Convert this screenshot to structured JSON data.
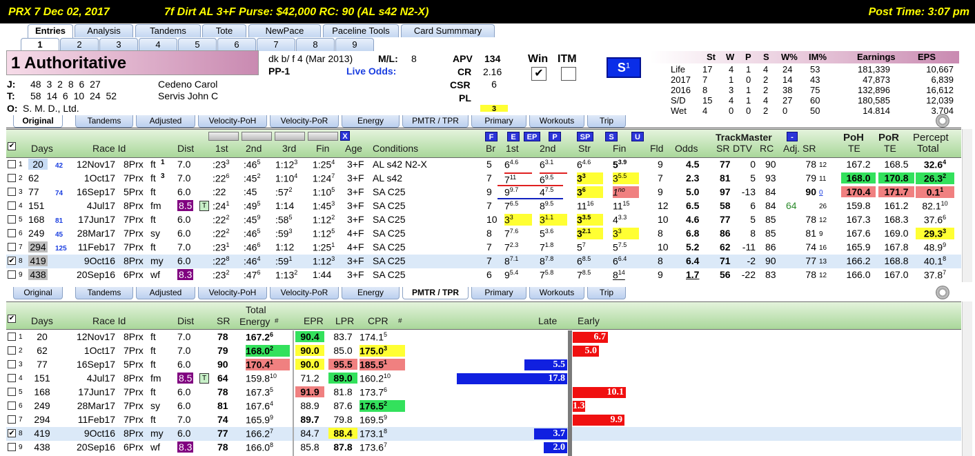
{
  "topbar": {
    "race": "PRX  7   Dec 02, 2017",
    "surface": "7f  Dirt   AL  3+F   Purse: $42,000   RC: 90  (AL s42 N2-X)",
    "post": "Post Time: 3:07 pm"
  },
  "main_tabs": [
    "Entries",
    "Analysis",
    "Tandems",
    "Tote",
    "NewPace",
    "Paceline Tools",
    "Card Summmary"
  ],
  "horse_tabs": [
    "1",
    "2",
    "3",
    "4",
    "5",
    "6",
    "7",
    "8",
    "9"
  ],
  "horse": {
    "name": "1  Authoritative",
    "breeding": "dk b/ f 4  (Mar 2013)",
    "ml_label": "M/L:",
    "ml": "8",
    "pp": "PP-1",
    "live_odds": "Live Odds:",
    "j_label": "J:",
    "j_stats": "48    3    2    8     6    27",
    "jockey": "Cedeno Carol",
    "t_label": "T:",
    "t_stats": "58   14    6   10    24    52",
    "trainer": "Servis John C",
    "o_label": "O:",
    "owner": "S. M. D., Ltd."
  },
  "ratings": {
    "apv_label": "APV",
    "apv": "134",
    "cr_label": "CR",
    "cr": "2.16",
    "csr_label": "CSR",
    "csr": "6",
    "pl_label": "PL",
    "pl": "3"
  },
  "winitm": {
    "win": "Win",
    "itm": "ITM",
    "check": "✔",
    "s_badge": "S",
    "s_num": "1"
  },
  "records": {
    "headers": [
      "St",
      "W",
      "P",
      "S",
      "W%",
      "IM%",
      "Earnings",
      "EPS"
    ],
    "rows": [
      [
        "Life",
        "17",
        "4",
        "1",
        "4",
        "24",
        "53",
        "181,339",
        "10,667"
      ],
      [
        "2017",
        "7",
        "1",
        "0",
        "2",
        "14",
        "43",
        "47,873",
        "6,839"
      ],
      [
        "2016",
        "8",
        "3",
        "1",
        "2",
        "38",
        "75",
        "132,896",
        "16,612"
      ],
      [
        "S/D",
        "15",
        "4",
        "1",
        "4",
        "27",
        "60",
        "180,585",
        "12,039"
      ],
      [
        "Wet",
        "4",
        "0",
        "0",
        "2",
        "0",
        "50",
        "14,814",
        "3,704"
      ]
    ]
  },
  "subtabs": [
    "Original",
    "Tandems",
    "Adjusted",
    "Velocity-PoH",
    "Velocity-PoR",
    "Energy",
    "PMTR / TPR",
    "Primary",
    "Workouts",
    "Trip"
  ],
  "upper_headers": {
    "days": "Days",
    "raceid": "Race Id",
    "dist": "Dist",
    "first": "1st",
    "second": "2nd",
    "third": "3rd",
    "fin": "Fin",
    "age": "Age",
    "cond": "Conditions",
    "x": "X",
    "br": "Br",
    "b1st": "1st",
    "b2nd": "2nd",
    "str": "Str",
    "bfin": "Fin",
    "fld": "Fld",
    "odds": "Odds",
    "tm": "TrackMaster",
    "sr": "SR",
    "dtv": "DTV",
    "rc": "RC",
    "minus": "-",
    "adjsr": "Adj. SR",
    "poh": "PoH",
    "te1": "TE",
    "por": "PoR",
    "te2": "TE",
    "pct": "Percept",
    "total": "Total",
    "btn_f": "F",
    "btn_e": "E",
    "btn_ep": "EP",
    "btn_p": "P",
    "btn_sp": "SP",
    "btn_s": "S",
    "btn_u": "U"
  },
  "upper_rows": [
    {
      "n": "1",
      "days": "20",
      "dg": "42",
      "date": "12Nov17",
      "rn": "8Prx",
      "surf": "ft",
      "surfsup": "1",
      "dist": "7.0",
      "f1": ":23",
      "f1s": "3",
      "f2": ":46",
      "f2s": "5",
      "f3": "1:12",
      "f3s": "3",
      "fin": "1:25",
      "fins": "4",
      "age": "3+F",
      "cond": "AL s42 N2-X",
      "br": "5",
      "c1": "6",
      "c1s": "4.6",
      "c2": "6",
      "c2s": "3.1",
      "str": "6",
      "strs": "4.6",
      "cf": "5",
      "cfs": "3.9",
      "fld": "9",
      "odds": "4.5",
      "sr": "77",
      "dtv": "0",
      "rc": "90",
      "adj": "78",
      "adjs": "12",
      "poh": "167.2",
      "por": "168.5",
      "pt": "32.6",
      "pts": "4"
    },
    {
      "n": "2",
      "days": "62",
      "dg": "",
      "date": "1Oct17",
      "rn": "7Prx",
      "surf": "ft",
      "surfsup": "3",
      "dist": "7.0",
      "f1": ":22",
      "f1s": "6",
      "f2": ":45",
      "f2s": "2",
      "f3": "1:10",
      "f3s": "4",
      "fin": "1:24",
      "fins": "7",
      "age": "3+F",
      "cond": "AL s42",
      "br": "7",
      "c1": "7",
      "c1s": "11",
      "c2": "6",
      "c2s": "9.5",
      "str": "3",
      "strs": "3",
      "cf": "3",
      "cfs": "5.5",
      "fld": "7",
      "odds": "2.3",
      "sr": "81",
      "dtv": "5",
      "rc": "93",
      "adj": "79",
      "adjs": "11",
      "poh": "168.0",
      "por": "170.8",
      "pt": "26.3",
      "pts": "2"
    },
    {
      "n": "3",
      "days": "77",
      "dg": "74",
      "date": "16Sep17",
      "rn": "5Prx",
      "surf": "ft",
      "surfsup": "",
      "dist": "6.0",
      "f1": ":22",
      "f1s": "",
      "f2": ":45",
      "f2s": "",
      "f3": ":57",
      "f3s": "2",
      "fin": "1:10",
      "fins": "5",
      "age": "3+F",
      "cond": "SA  C25",
      "br": "9",
      "c1": "9",
      "c1s": "9.7",
      "c2": "4",
      "c2s": "7.5",
      "str": "3",
      "strs": "6",
      "cf": "1",
      "cfs": "no",
      "fld": "9",
      "odds": "5.0",
      "sr": "97",
      "dtv": "-13",
      "rc": "84",
      "adj": "90",
      "adjs": "0",
      "poh": "170.4",
      "por": "171.7",
      "pt": "0.1",
      "pts": "1"
    },
    {
      "n": "4",
      "days": "151",
      "dg": "",
      "date": "4Jul17",
      "rn": "8Prx",
      "surf": "fm",
      "surfsup": "",
      "dist": "8.5",
      "f1": ":24",
      "f1s": "1",
      "f2": ":49",
      "f2s": "5",
      "f3": "1:14",
      "f3s": "",
      "fin": "1:45",
      "fins": "3",
      "age": "3+F",
      "cond": "SA  C25",
      "br": "7",
      "c1": "7",
      "c1s": "6.5",
      "c2": "8",
      "c2s": "9.5",
      "str": "11",
      "strs": "16",
      "cf": "11",
      "cfs": "15",
      "fld": "12",
      "odds": "6.5",
      "sr": "58",
      "dtv": "6",
      "rc": "84",
      "adj": "64",
      "adjs": "26",
      "poh": "159.8",
      "por": "161.2",
      "pt": "82.1",
      "pts": "10"
    },
    {
      "n": "5",
      "days": "168",
      "dg": "81",
      "date": "17Jun17",
      "rn": "7Prx",
      "surf": "ft",
      "surfsup": "",
      "dist": "6.0",
      "f1": ":22",
      "f1s": "2",
      "f2": ":45",
      "f2s": "9",
      "f3": ":58",
      "f3s": "5",
      "fin": "1:12",
      "fins": "2",
      "age": "3+F",
      "cond": "SA  C25",
      "br": "10",
      "c1": "3",
      "c1s": "3",
      "c2": "3",
      "c2s": "1.1",
      "str": "3",
      "strs": "3.5",
      "cf": "4",
      "cfs": "3.3",
      "fld": "10",
      "odds": "4.6",
      "sr": "77",
      "dtv": "5",
      "rc": "85",
      "adj": "78",
      "adjs": "12",
      "poh": "167.3",
      "por": "168.3",
      "pt": "37.6",
      "pts": "6"
    },
    {
      "n": "6",
      "days": "249",
      "dg": "45",
      "date": "28Mar17",
      "rn": "7Prx",
      "surf": "sy",
      "surfsup": "",
      "dist": "6.0",
      "f1": ":22",
      "f1s": "2",
      "f2": ":46",
      "f2s": "5",
      "f3": ":59",
      "f3s": "3",
      "fin": "1:12",
      "fins": "5",
      "age": "4+F",
      "cond": "SA  C25",
      "br": "8",
      "c1": "7",
      "c1s": "7.6",
      "c2": "5",
      "c2s": "3.6",
      "str": "3",
      "strs": "2.1",
      "cf": "3",
      "cfs": "3",
      "fld": "8",
      "odds": "6.8",
      "sr": "86",
      "dtv": "8",
      "rc": "85",
      "adj": "81",
      "adjs": "9",
      "poh": "167.6",
      "por": "169.0",
      "pt": "29.3",
      "pts": "3"
    },
    {
      "n": "7",
      "days": "294",
      "dg": "125",
      "date": "11Feb17",
      "rn": "7Prx",
      "surf": "ft",
      "surfsup": "",
      "dist": "7.0",
      "f1": ":23",
      "f1s": "1",
      "f2": ":46",
      "f2s": "6",
      "f3": "1:12",
      "f3s": "",
      "fin": "1:25",
      "fins": "1",
      "age": "4+F",
      "cond": "SA  C25",
      "br": "7",
      "c1": "7",
      "c1s": "2.3",
      "c2": "7",
      "c2s": "1.8",
      "str": "5",
      "strs": "7",
      "cf": "5",
      "cfs": "7.5",
      "fld": "10",
      "odds": "5.2",
      "sr": "62",
      "dtv": "-11",
      "rc": "86",
      "adj": "74",
      "adjs": "16",
      "poh": "165.9",
      "por": "167.8",
      "pt": "48.9",
      "pts": "9"
    },
    {
      "n": "8",
      "days": "419",
      "dg": "",
      "date": "9Oct16",
      "rn": "8Prx",
      "surf": "my",
      "surfsup": "",
      "dist": "6.0",
      "f1": ":22",
      "f1s": "8",
      "f2": ":46",
      "f2s": "4",
      "f3": ":59",
      "f3s": "1",
      "fin": "1:12",
      "fins": "3",
      "age": "3+F",
      "cond": "SA  C25",
      "br": "7",
      "c1": "8",
      "c1s": "7.1",
      "c2": "8",
      "c2s": "7.8",
      "str": "6",
      "strs": "8.5",
      "cf": "6",
      "cfs": "6.4",
      "fld": "8",
      "odds": "6.4",
      "sr": "71",
      "dtv": "-2",
      "rc": "90",
      "adj": "77",
      "adjs": "13",
      "poh": "166.2",
      "por": "168.8",
      "pt": "40.1",
      "pts": "8"
    },
    {
      "n": "9",
      "days": "438",
      "dg": "",
      "date": "20Sep16",
      "rn": "6Prx",
      "surf": "wf",
      "surfsup": "",
      "dist": "8.3",
      "f1": ":23",
      "f1s": "2",
      "f2": ":47",
      "f2s": "6",
      "f3": "1:13",
      "f3s": "2",
      "fin": "1:44",
      "fins": "",
      "age": "3+F",
      "cond": "SA  C25",
      "br": "6",
      "c1": "9",
      "c1s": "5.4",
      "c2": "7",
      "c2s": "5.8",
      "str": "7",
      "strs": "8.5",
      "cf": "8",
      "cfs": "14",
      "fld": "9",
      "odds": "1.7",
      "sr": "56",
      "dtv": "-22",
      "rc": "83",
      "adj": "78",
      "adjs": "12",
      "poh": "166.0",
      "por": "167.0",
      "pt": "37.8",
      "pts": "7"
    }
  ],
  "lower_headers": {
    "days": "Days",
    "raceid": "Race Id",
    "dist": "Dist",
    "sr": "SR",
    "total": "Total",
    "energy": "Energy",
    "hash": "#",
    "epr": "EPR",
    "lpr": "LPR",
    "cpr": "CPR",
    "hash2": "#",
    "late": "Late",
    "early": "Early"
  },
  "lower_rows": [
    {
      "n": "1",
      "days": "20",
      "date": "12Nov17",
      "rn": "8Prx",
      "surf": "ft",
      "dist": "7.0",
      "sr": "78",
      "te": "167.2",
      "tes": "6",
      "epr": "90.4",
      "lpr": "83.7",
      "cpr": "174.1",
      "cn": "5",
      "late": "",
      "early": "6.7"
    },
    {
      "n": "2",
      "days": "62",
      "date": "1Oct17",
      "rn": "7Prx",
      "surf": "ft",
      "dist": "7.0",
      "sr": "79",
      "te": "168.0",
      "tes": "2",
      "epr": "90.0",
      "lpr": "85.0",
      "cpr": "175.0",
      "cn": "3",
      "late": "",
      "early": "5.0"
    },
    {
      "n": "3",
      "days": "77",
      "date": "16Sep17",
      "rn": "5Prx",
      "surf": "ft",
      "dist": "6.0",
      "sr": "90",
      "te": "170.4",
      "tes": "1",
      "epr": "90.0",
      "lpr": "95.5",
      "cpr": "185.5",
      "cn": "1",
      "late": "5.5",
      "early": ""
    },
    {
      "n": "4",
      "days": "151",
      "date": "4Jul17",
      "rn": "8Prx",
      "surf": "fm",
      "dist": "8.5",
      "sr": "64",
      "te": "159.8",
      "tes": "10",
      "epr": "71.2",
      "lpr": "89.0",
      "cpr": "160.2",
      "cn": "10",
      "late": "17.8",
      "early": ""
    },
    {
      "n": "5",
      "days": "168",
      "date": "17Jun17",
      "rn": "7Prx",
      "surf": "ft",
      "dist": "6.0",
      "sr": "78",
      "te": "167.3",
      "tes": "5",
      "epr": "91.9",
      "lpr": "81.8",
      "cpr": "173.7",
      "cn": "6",
      "late": "",
      "early": "10.1"
    },
    {
      "n": "6",
      "days": "249",
      "date": "28Mar17",
      "rn": "7Prx",
      "surf": "sy",
      "dist": "6.0",
      "sr": "81",
      "te": "167.6",
      "tes": "4",
      "epr": "88.9",
      "lpr": "87.6",
      "cpr": "176.5",
      "cn": "2",
      "late": "",
      "early": "1.3"
    },
    {
      "n": "7",
      "days": "294",
      "date": "11Feb17",
      "rn": "7Prx",
      "surf": "ft",
      "dist": "7.0",
      "sr": "74",
      "te": "165.9",
      "tes": "9",
      "epr": "89.7",
      "lpr": "79.8",
      "cpr": "169.5",
      "cn": "9",
      "late": "",
      "early": "9.9"
    },
    {
      "n": "8",
      "days": "419",
      "date": "9Oct16",
      "rn": "8Prx",
      "surf": "my",
      "dist": "6.0",
      "sr": "77",
      "te": "166.2",
      "tes": "7",
      "epr": "84.7",
      "lpr": "88.4",
      "cpr": "173.1",
      "cn": "8",
      "late": "3.7",
      "early": ""
    },
    {
      "n": "9",
      "days": "438",
      "date": "20Sep16",
      "rn": "6Prx",
      "surf": "wf",
      "dist": "8.3",
      "sr": "78",
      "te": "166.0",
      "tes": "8",
      "epr": "85.8",
      "lpr": "87.8",
      "cpr": "173.6",
      "cn": "7",
      "late": "2.0",
      "early": ""
    }
  ],
  "colors": {
    "topbar_bg": "#000000",
    "topbar_text": "#ffff00",
    "header_green": "#a9d79a",
    "highlight_yellow": "#ffff33",
    "highlight_green": "#33e15c",
    "highlight_red": "#f08080",
    "late_bar": "#1020e0",
    "early_bar": "#f01010"
  },
  "icons": {
    "check": "✔",
    "gear": "gear-icon",
    "x": "X"
  }
}
